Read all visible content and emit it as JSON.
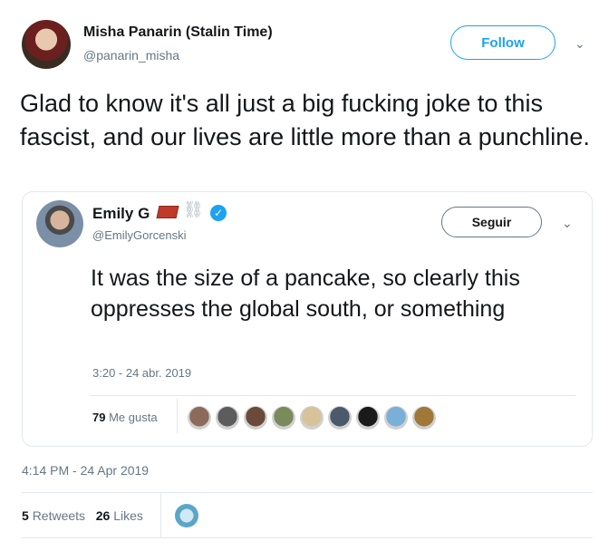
{
  "tweet": {
    "author_name": "Misha Panarin (Stalin Time)",
    "author_handle": "@panarin_misha",
    "follow_label": "Follow",
    "text": "Glad to know it's all just a big fucking joke to this fascist, and our lives are little more than a punchline.",
    "timestamp": "4:14 PM - 24 Apr 2019",
    "retweets_count": "5",
    "retweets_label": "Retweets",
    "likes_count": "26",
    "likes_label": "Likes"
  },
  "quoted": {
    "author_name": "Emily G",
    "author_handle": "@EmilyGorcenski",
    "follow_label": "Seguir",
    "text": "It was the size of a pancake, so clearly this oppresses the global south, or something",
    "timestamp": "3:20 - 24 abr. 2019",
    "likes_count": "79",
    "likes_label": "Me gusta",
    "liker_colors": [
      "#8c6b5a",
      "#5c5c5c",
      "#6b4a3a",
      "#7a8a5a",
      "#d8c29a",
      "#4a5a6a",
      "#1a1a1a",
      "#7ab0d8",
      "#a0783a"
    ]
  },
  "icons": {
    "chevron": "chevron-down-icon",
    "verified": "verified-badge-icon",
    "brick": "brick-emoji-icon",
    "chain": "chain-emoji-icon"
  }
}
